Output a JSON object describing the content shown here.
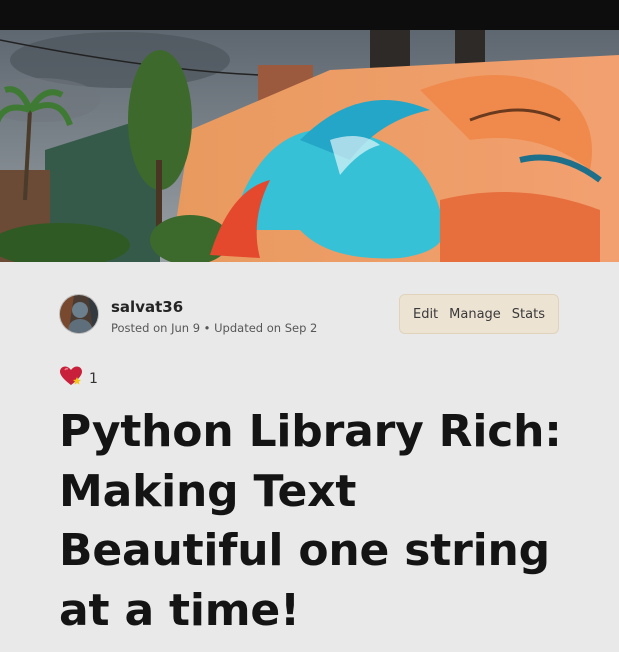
{
  "cover": {
    "image": "street-art-mural-cover"
  },
  "author": {
    "name": "salvat36",
    "posted": "Posted on Jun 9",
    "separator": "•",
    "updated": "Updated on Sep 2",
    "avatar": "avatar-image"
  },
  "actions": {
    "edit": "Edit",
    "manage": "Manage",
    "stats": "Stats"
  },
  "reactions": {
    "icon": "sparkle-heart-icon",
    "count": "1"
  },
  "article": {
    "title": "Python Library Rich: Making Text Beautiful one string at a time!"
  },
  "colors": {
    "background": "#e9e9e9",
    "actions_bg": "#ece3d3",
    "title": "#141414"
  }
}
